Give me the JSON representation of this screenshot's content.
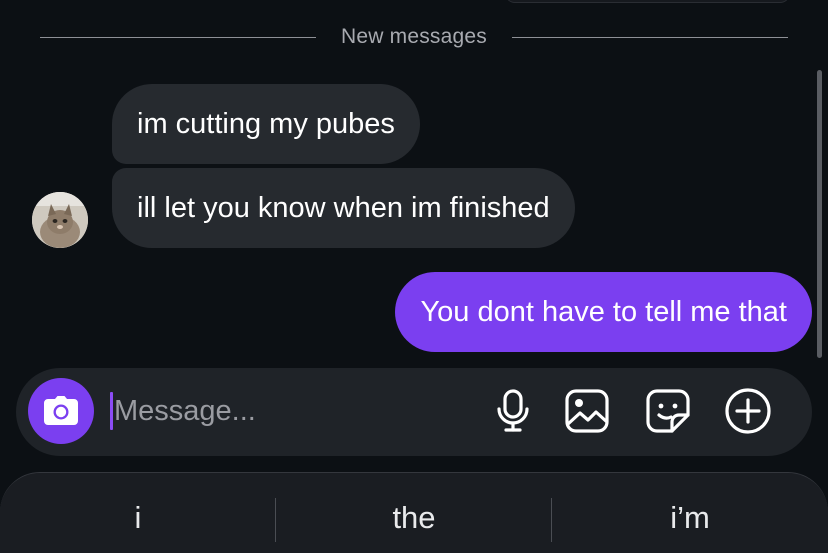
{
  "divider": {
    "label": "New messages"
  },
  "messages": {
    "incoming": [
      {
        "text": "im cutting my pubes"
      },
      {
        "text": "ill let you know when im finished"
      }
    ],
    "outgoing": [
      {
        "text": "You dont have to tell me that"
      }
    ]
  },
  "composer": {
    "placeholder": "Message...",
    "icons": [
      "camera-icon",
      "microphone-icon",
      "image-icon",
      "sticker-icon",
      "plus-icon"
    ]
  },
  "keyboard": {
    "suggestions": [
      "i",
      "the",
      "i’m"
    ]
  },
  "colors": {
    "background": "#0c1014",
    "incoming_bubble": "#262a2f",
    "outgoing_bubble": "#7b3ff0",
    "accent": "#7b3ff0"
  }
}
